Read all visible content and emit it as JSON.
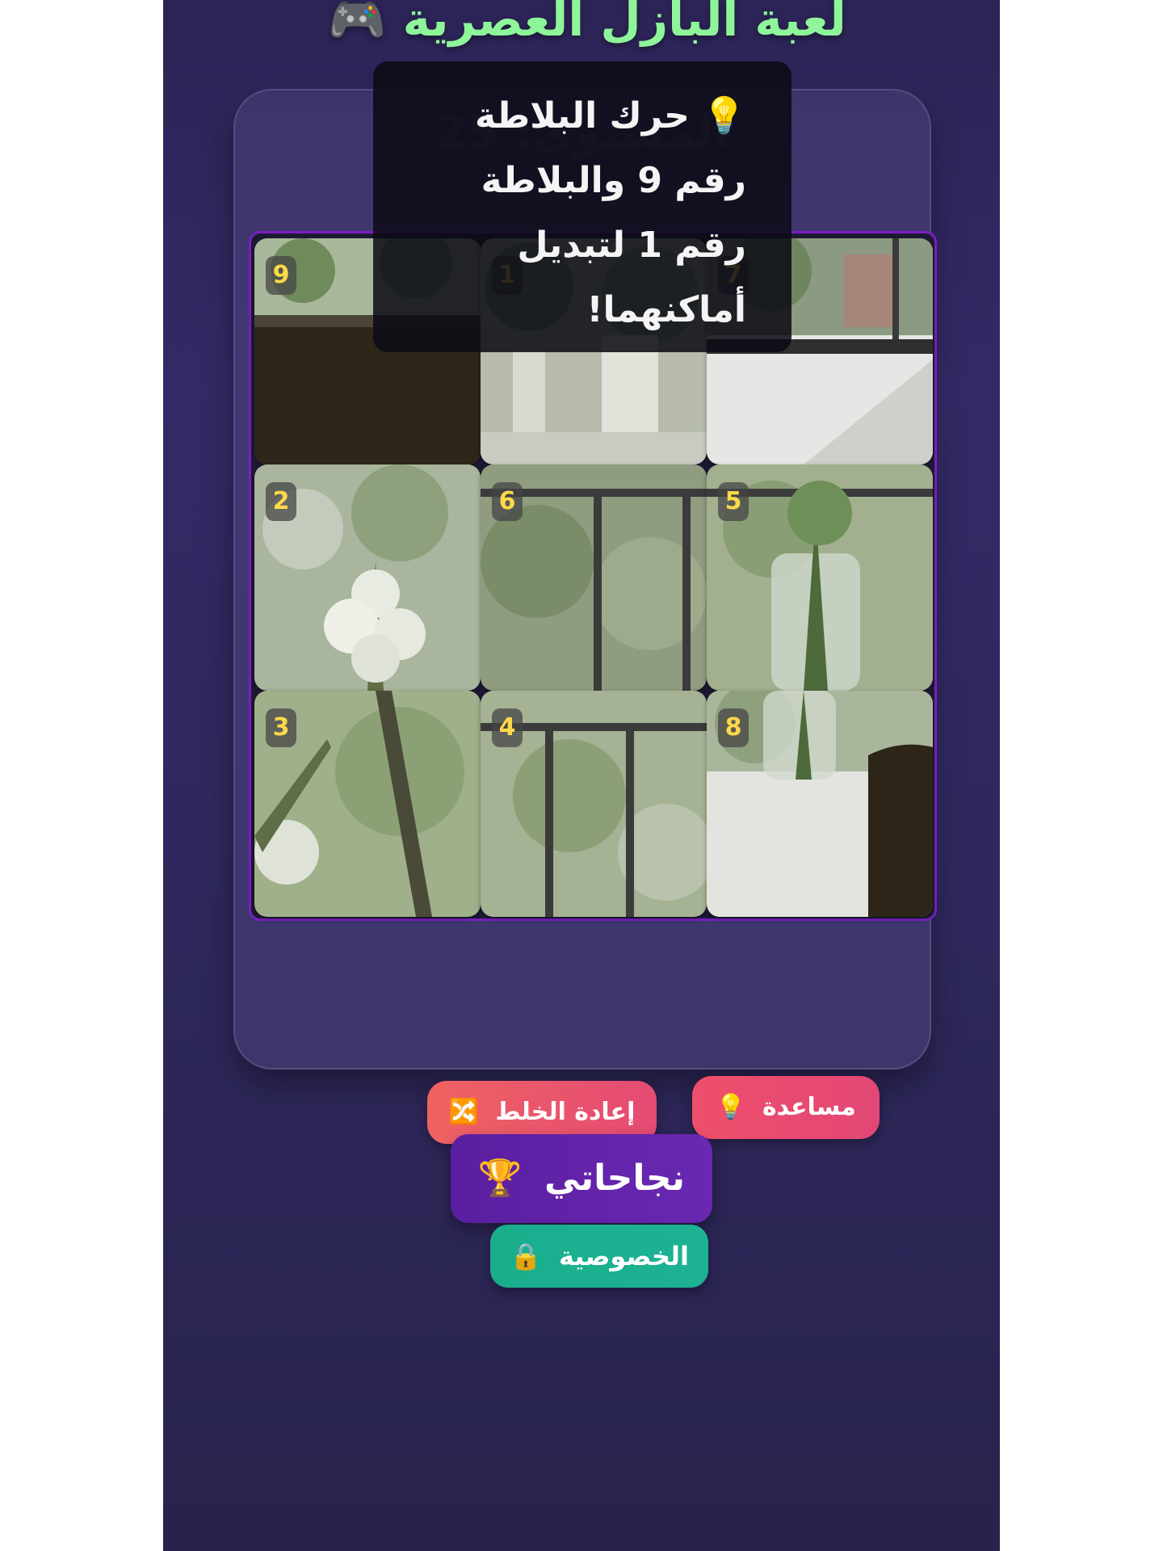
{
  "header": {
    "title": "لعبة البازل العصرية",
    "icon": "gamepad-icon"
  },
  "game": {
    "level_text": "المستوى: 25",
    "tiles": [
      {
        "number": "9"
      },
      {
        "number": "1"
      },
      {
        "number": "7"
      },
      {
        "number": "2"
      },
      {
        "number": "6"
      },
      {
        "number": "5"
      },
      {
        "number": "3"
      },
      {
        "number": "4"
      },
      {
        "number": "8"
      }
    ]
  },
  "hint": {
    "text": "حرك البلاطة رقم 9 والبلاطة رقم 1 لتبديل أماكنهما!",
    "icon": "lightbulb-icon"
  },
  "controls": {
    "help_label": "مساعدة",
    "help_icon": "lightbulb-icon",
    "shuffle_label": "إعادة الخلط",
    "shuffle_icon": "shuffle-icon"
  },
  "footer": {
    "achievements_label": "نجاحاتي",
    "achievements_icon": "trophy-icon",
    "privacy_label": "الخصوصية",
    "privacy_icon": "lock-icon"
  },
  "colors": {
    "accent_green": "#8ef59a",
    "board_border": "#7a1fc0",
    "help_button": "#ef4f6b",
    "achievements_button": "#5a1ea0",
    "privacy_button": "#1aae8c"
  }
}
